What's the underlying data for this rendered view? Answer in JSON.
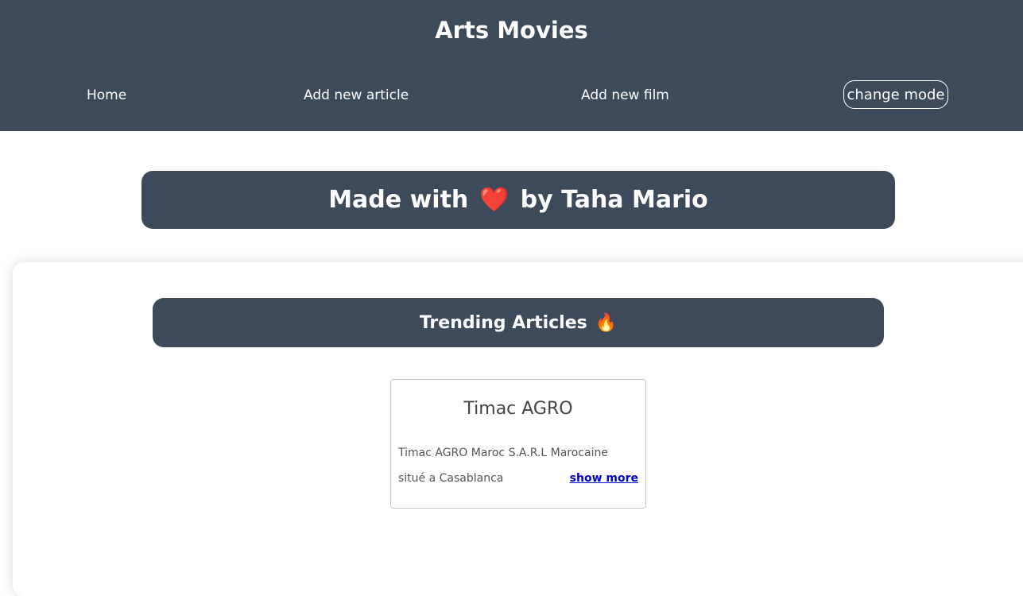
{
  "header": {
    "title": "Arts Movies",
    "nav": [
      {
        "label": "Home"
      },
      {
        "label": "Add new article"
      },
      {
        "label": "Add new film"
      }
    ],
    "mode_button": "change mode"
  },
  "banner": {
    "text_before": "Made with",
    "heart": "❤️",
    "text_after": "by Taha Mario"
  },
  "trending": {
    "title": "Trending Articles",
    "icon": "🔥",
    "articles": [
      {
        "title": "Timac AGRO",
        "description": "Timac AGRO Maroc S.A.R.L Marocaine situé a Casablanca",
        "link_label": "show more"
      }
    ]
  },
  "colors": {
    "header_bg": "#3d4a5a",
    "link": "#0000cc"
  }
}
